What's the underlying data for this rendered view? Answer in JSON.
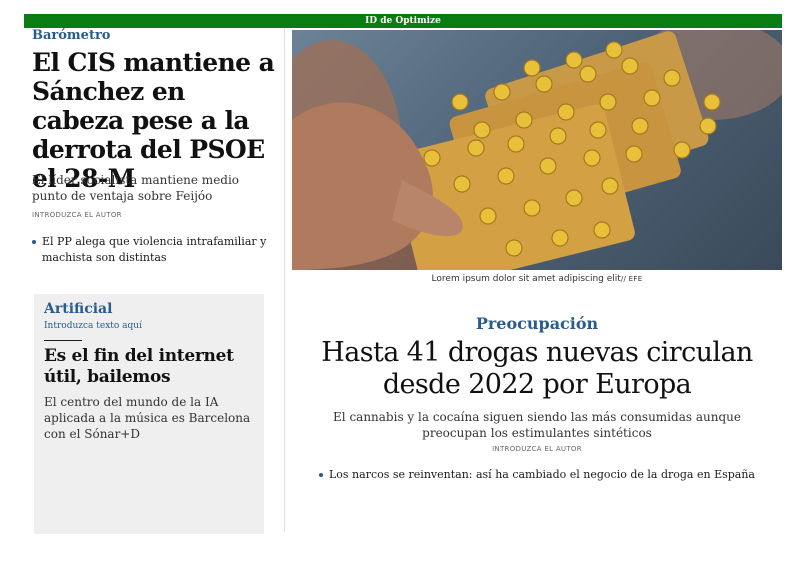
{
  "topbar": {
    "label": "ID de Optimize"
  },
  "lead": {
    "kicker": "Barómetro",
    "headline": "El CIS mantiene a Sánchez en cabeza pese a la derrota del PSOE el 28-M",
    "subtitle": "El líder socialista mantiene medio punto de ventaja sobre Feijóo",
    "author": "INTRODUZCA EL AUTOR",
    "related": "El PP alega que violencia intrafamiliar y machista son distintas"
  },
  "artificial": {
    "kicker": "Artificial",
    "tag": "Introduzca texto aquí",
    "headline": "Es el fin del internet útil, bailemos",
    "subtitle": "El centro del mundo de la IA aplicada a la música es Barcelona con el Sónar+D"
  },
  "photo": {
    "caption": "Lorem ipsum dolor sit amet adipiscing elit",
    "source": "// EFE"
  },
  "feature": {
    "kicker": "Preocupación",
    "headline": "Hasta 41 drogas nuevas circulan desde 2022 por Europa",
    "subtitle": "El cannabis y la cocaína siguen siendo las más consumidas aunque preocupan los estimulantes sintéticos",
    "author": "INTRODUZCA EL AUTOR",
    "related": "Los narcos se reinventan: así ha cambiado el negocio de la droga en España"
  },
  "colors": {
    "accent": "#2a5b8f",
    "topbar": "#0a7d12"
  }
}
